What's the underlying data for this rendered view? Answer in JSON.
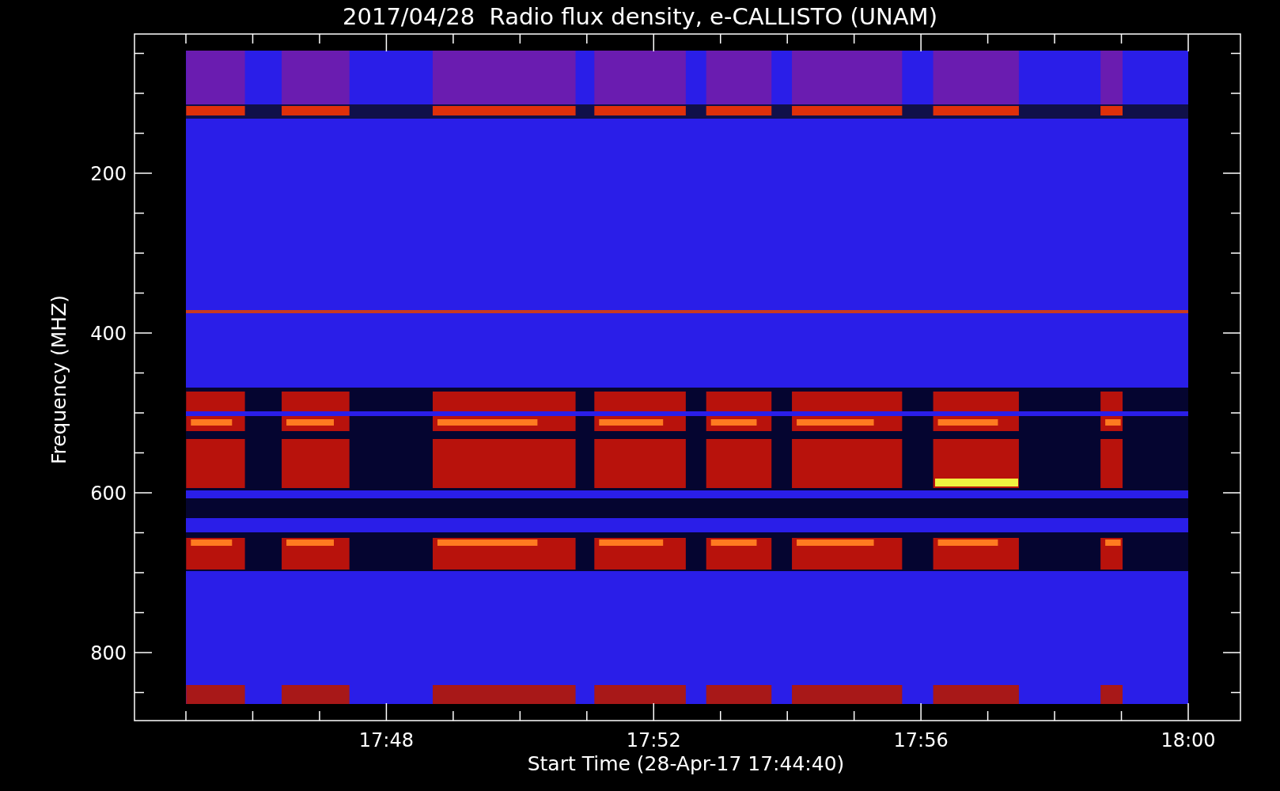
{
  "title": "2017/04/28  Radio flux density, e-CALLISTO (UNAM)",
  "ylabel": "Frequency (MHZ)",
  "xlabel": "Start Time (28-Apr-17 17:44:40)",
  "yticks": [
    "200",
    "400",
    "600",
    "800"
  ],
  "xticks": [
    "17:48",
    "17:52",
    "17:56",
    "18:00"
  ]
}
